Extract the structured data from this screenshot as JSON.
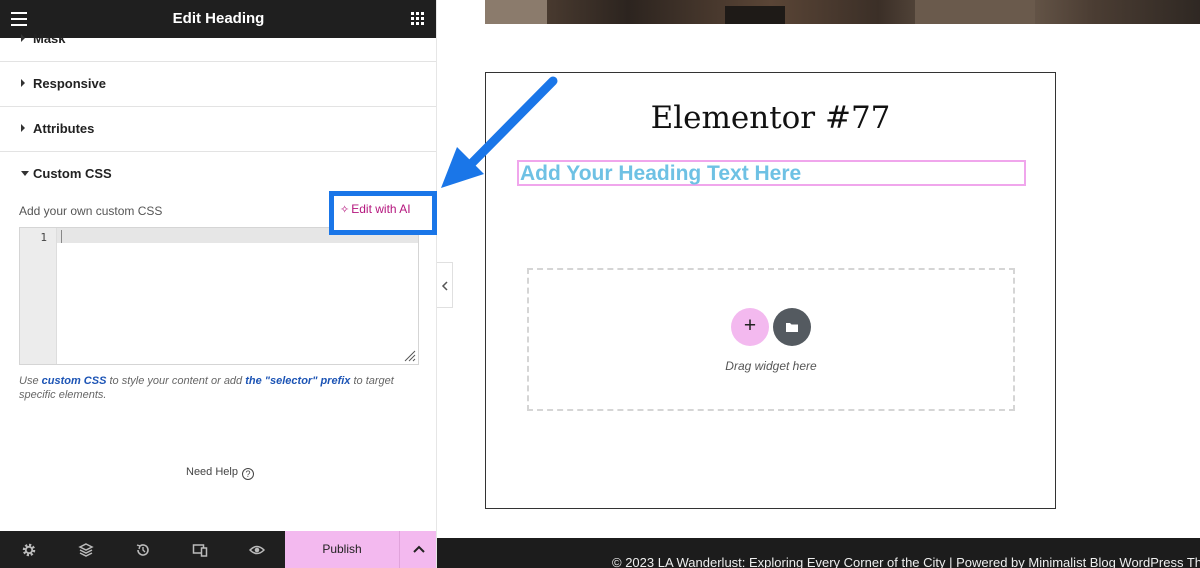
{
  "topbar": {
    "title": "Edit Heading"
  },
  "sections": {
    "mask": "Mask",
    "responsive": "Responsive",
    "attributes": "Attributes",
    "custom_css": "Custom CSS"
  },
  "custom_css": {
    "description": "Add your own custom CSS",
    "ai_button": "Edit with AI",
    "line_number": "1",
    "note_prefix": "Use ",
    "note_link1": "custom CSS",
    "note_mid": " to style your content or add ",
    "note_link2": "the \"selector\" prefix",
    "note_suffix": " to target specific elements."
  },
  "help": {
    "label": "Need Help",
    "icon_char": "?"
  },
  "bottombar": {
    "publish": "Publish"
  },
  "canvas": {
    "page_title": "Elementor #77",
    "heading": "Add Your Heading Text Here",
    "add_symbol": "+",
    "drop_label": "Drag widget here"
  },
  "footer": {
    "text": "© 2023 LA Wanderlust: Exploring Every Corner of the City | Powered by Minimalist Blog WordPress Th"
  },
  "colors": {
    "topbar_bg": "#1f1f1f",
    "publish_bg": "#f3b9ef",
    "ai_text": "#b4157d",
    "highlight_frame": "#1a76e8",
    "heading_text": "#6ec1e4",
    "link": "#1c54b5"
  },
  "icons": [
    "hamburger-icon",
    "apps-grid-icon",
    "settings-icon",
    "layers-icon",
    "history-icon",
    "responsive-icon",
    "preview-eye-icon",
    "chevron-up-icon",
    "sparkle-icon",
    "help-icon",
    "plus-icon",
    "folder-icon",
    "chevron-left-icon",
    "arrow-pointer"
  ]
}
